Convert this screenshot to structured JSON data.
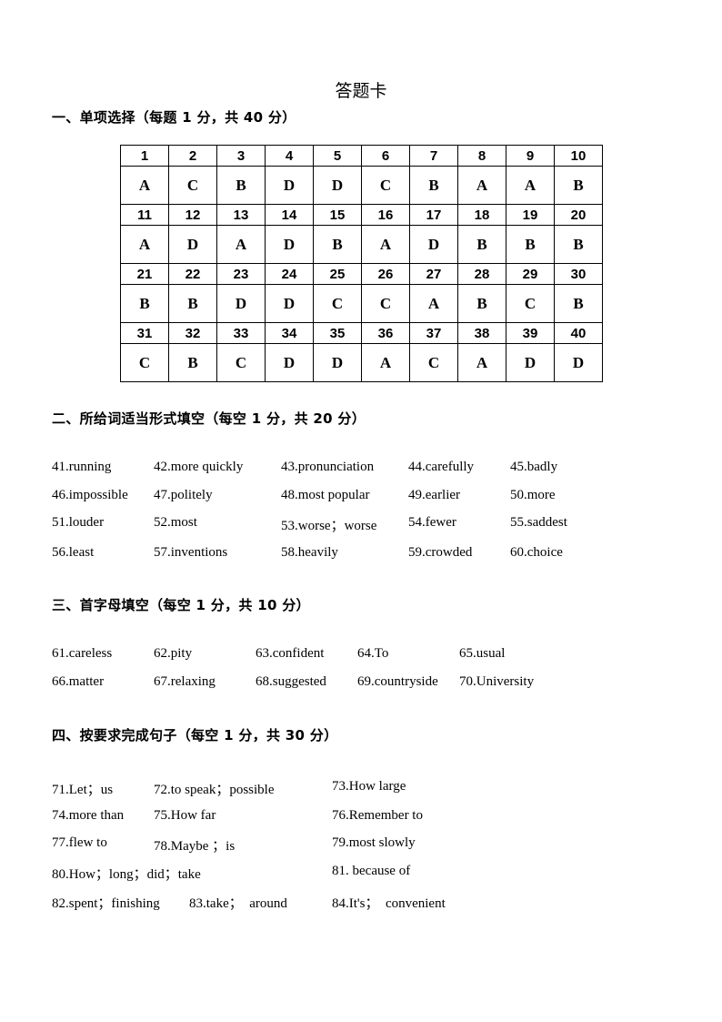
{
  "title": "答题卡",
  "section1": {
    "heading": "一、单项选择（每题 1 分，共 40 分）",
    "rows": [
      {
        "numbers": [
          "1",
          "2",
          "3",
          "4",
          "5",
          "6",
          "7",
          "8",
          "9",
          "10"
        ],
        "answers": [
          "A",
          "C",
          "B",
          "D",
          "D",
          "C",
          "B",
          "A",
          "A",
          "B"
        ]
      },
      {
        "numbers": [
          "11",
          "12",
          "13",
          "14",
          "15",
          "16",
          "17",
          "18",
          "19",
          "20"
        ],
        "answers": [
          "A",
          "D",
          "A",
          "D",
          "B",
          "A",
          "D",
          "B",
          "B",
          "B"
        ]
      },
      {
        "numbers": [
          "21",
          "22",
          "23",
          "24",
          "25",
          "26",
          "27",
          "28",
          "29",
          "30"
        ],
        "answers": [
          "B",
          "B",
          "D",
          "D",
          "C",
          "C",
          "A",
          "B",
          "C",
          "B"
        ]
      },
      {
        "numbers": [
          "31",
          "32",
          "33",
          "34",
          "35",
          "36",
          "37",
          "38",
          "39",
          "40"
        ],
        "answers": [
          "C",
          "B",
          "C",
          "D",
          "D",
          "A",
          "C",
          "A",
          "D",
          "D"
        ]
      }
    ]
  },
  "section2": {
    "heading": "二、所给词适当形式填空（每空 1 分，共 20 分）",
    "lines": [
      [
        "41.running",
        "42.more quickly",
        "43.pronunciation",
        "44.carefully",
        "45.badly"
      ],
      [
        "46.impossible",
        "47.politely",
        "48.most popular",
        "49.earlier",
        "50.more"
      ],
      [
        "51.louder",
        "52.most",
        "53.worse；worse",
        "54.fewer",
        "55.saddest"
      ],
      [
        "56.least",
        "57.inventions",
        "58.heavily",
        "59.crowded",
        "60.choice"
      ]
    ]
  },
  "section3": {
    "heading": "三、首字母填空（每空 1 分，共 10 分）",
    "lines": [
      [
        "61.careless",
        "62.pity",
        "63.confident",
        "64.To",
        "65.usual"
      ],
      [
        "66.matter",
        "67.relaxing",
        "68.suggested",
        "69.countryside",
        "70.University"
      ]
    ]
  },
  "section4": {
    "heading": "四、按要求完成句子（每空 1 分，共 30 分）",
    "lines": [
      [
        "71.Let；us",
        "72.to speak；possible",
        "73.How large"
      ],
      [
        "74.more than",
        "75.How far",
        "76.Remember to"
      ],
      [
        "77.flew to",
        "78.Maybe ；is",
        "79.most slowly"
      ],
      [
        "80.How；long；did；take",
        "81. because of"
      ],
      [
        "82.spent；finishing",
        "83.take；  around",
        "84.It's；  convenient"
      ]
    ]
  }
}
